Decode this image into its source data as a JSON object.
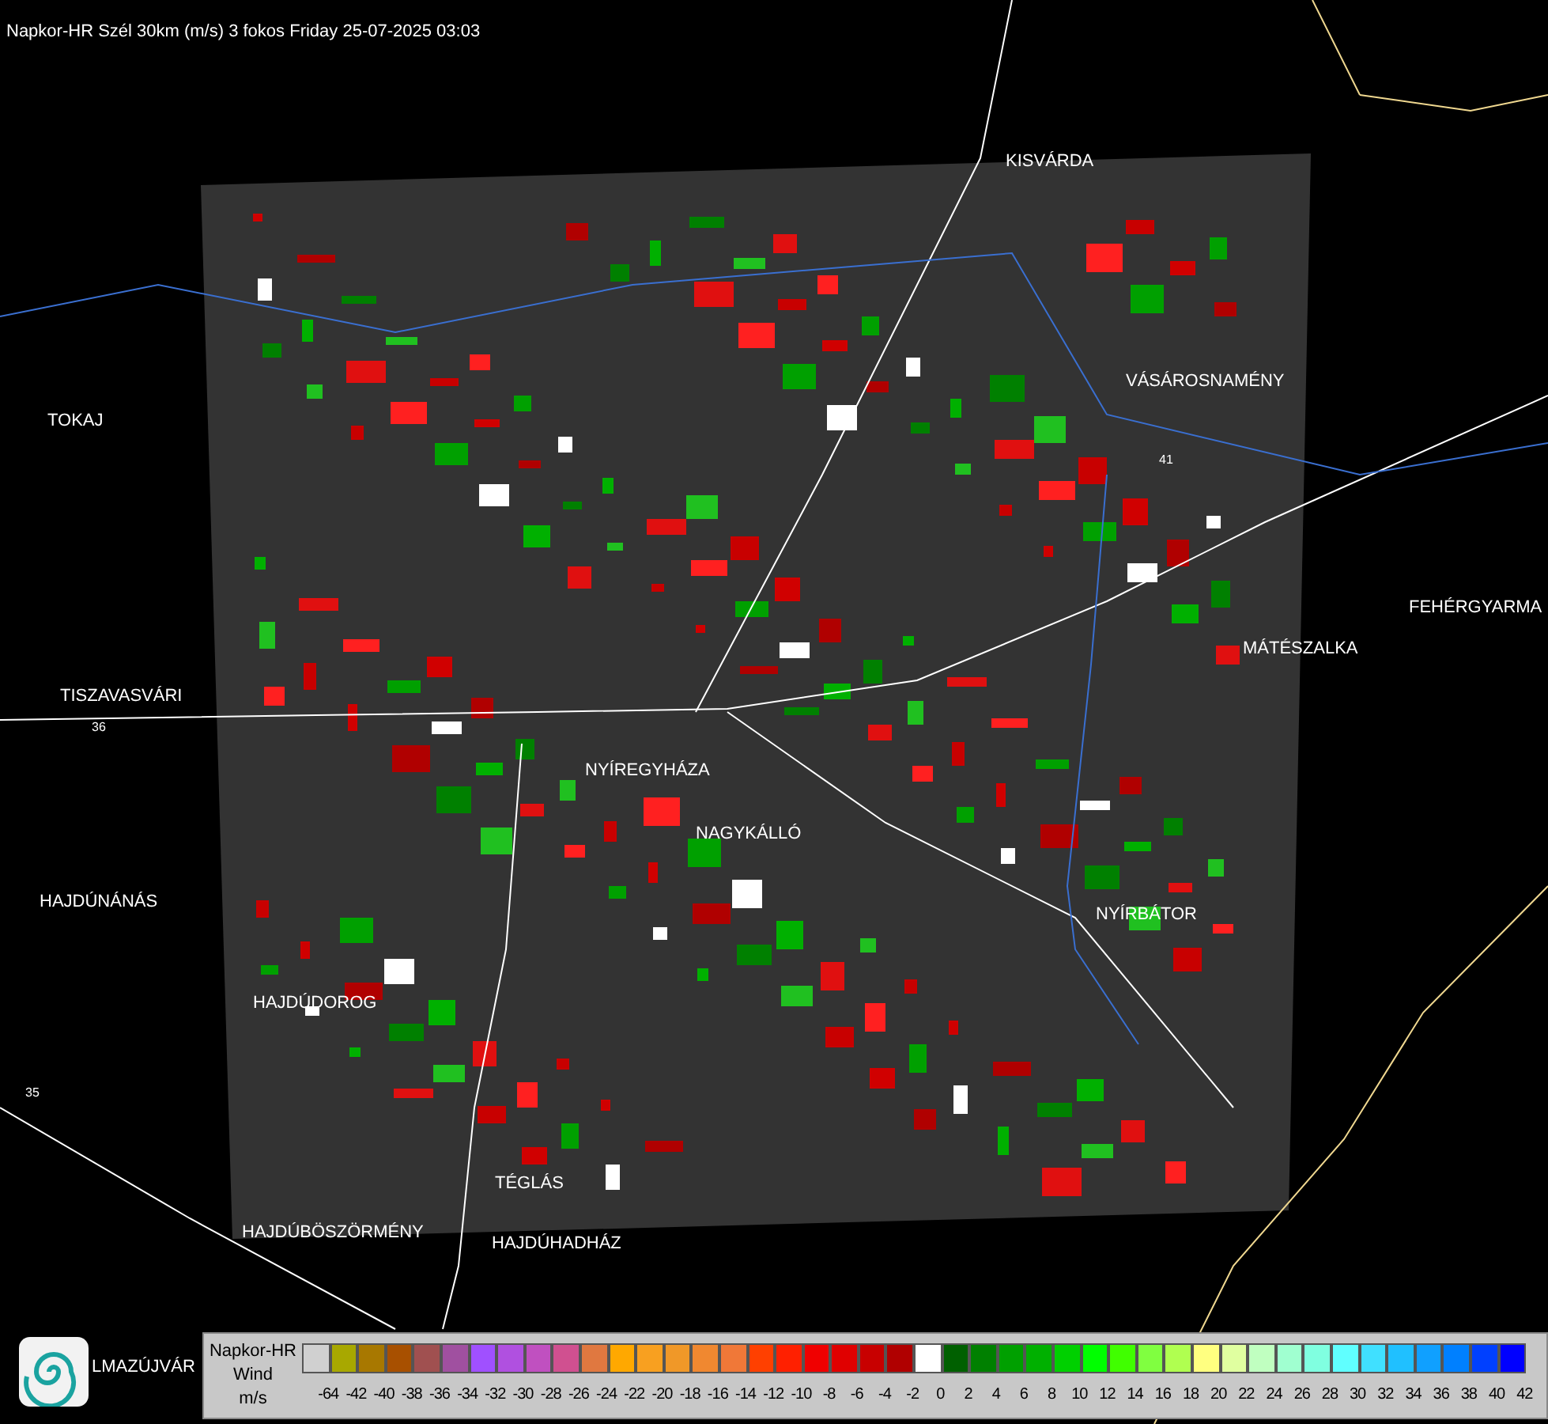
{
  "title": "Napkor-HR Szél 30km (m/s) 3 fokos Friday 25-07-2025 03:03",
  "map": {
    "cities": [
      {
        "name": "KISVÁRDA"
      },
      {
        "name": "VÁSÁROSNAMÉNY"
      },
      {
        "name": "TOKAJ"
      },
      {
        "name": "FEHÉRGYARMA"
      },
      {
        "name": "MÁTÉSZALKA"
      },
      {
        "name": "TISZAVASVÁRI"
      },
      {
        "name": "NYÍREGYHÁZA"
      },
      {
        "name": "NAGYKÁLLÓ"
      },
      {
        "name": "HAJDÚNÁNÁS"
      },
      {
        "name": "NYÍRBÁTOR"
      },
      {
        "name": "HAJDÚDOROG"
      },
      {
        "name": "TÉGLÁS"
      },
      {
        "name": "HAJDÚBÖSZÖRMÉNY"
      },
      {
        "name": "HAJDÚHADHÁZ"
      },
      {
        "name": "LMAZÚJVÁR"
      }
    ],
    "road_numbers": [
      "36",
      "41",
      "35"
    ]
  },
  "legend": {
    "lines": [
      "Napkor-HR",
      "Wind",
      "m/s"
    ],
    "scale": [
      {
        "color": "#d0d0d0",
        "label": "-64"
      },
      {
        "color": "#a8a800",
        "label": "-42"
      },
      {
        "color": "#a87800",
        "label": "-40"
      },
      {
        "color": "#a85000",
        "label": "-38"
      },
      {
        "color": "#a05050",
        "label": "-36"
      },
      {
        "color": "#a050a0",
        "label": "-34"
      },
      {
        "color": "#a050ff",
        "label": "-32"
      },
      {
        "color": "#b050e0",
        "label": "-30"
      },
      {
        "color": "#c050c0",
        "label": "-28"
      },
      {
        "color": "#d05090",
        "label": "-26"
      },
      {
        "color": "#e07840",
        "label": "-24"
      },
      {
        "color": "#ffa800",
        "label": "-22"
      },
      {
        "color": "#f8a020",
        "label": "-20"
      },
      {
        "color": "#f09828",
        "label": "-18"
      },
      {
        "color": "#f08830",
        "label": "-16"
      },
      {
        "color": "#f07838",
        "label": "-14"
      },
      {
        "color": "#ff4000",
        "label": "-12"
      },
      {
        "color": "#ff2000",
        "label": "-10"
      },
      {
        "color": "#f00000",
        "label": "-8"
      },
      {
        "color": "#e00000",
        "label": "-6"
      },
      {
        "color": "#c80000",
        "label": "-4"
      },
      {
        "color": "#b00000",
        "label": "-2"
      },
      {
        "color": "#ffffff",
        "label": "0"
      },
      {
        "color": "#006000",
        "label": "2"
      },
      {
        "color": "#008000",
        "label": "4"
      },
      {
        "color": "#00a000",
        "label": "6"
      },
      {
        "color": "#00b000",
        "label": "8"
      },
      {
        "color": "#00d000",
        "label": "10"
      },
      {
        "color": "#00ff00",
        "label": "12"
      },
      {
        "color": "#40ff00",
        "label": "14"
      },
      {
        "color": "#80ff40",
        "label": "16"
      },
      {
        "color": "#b0ff50",
        "label": "18"
      },
      {
        "color": "#ffff80",
        "label": "20"
      },
      {
        "color": "#e0ffa0",
        "label": "22"
      },
      {
        "color": "#c0ffc0",
        "label": "24"
      },
      {
        "color": "#a0ffd0",
        "label": "26"
      },
      {
        "color": "#80ffe0",
        "label": "28"
      },
      {
        "color": "#60ffff",
        "label": "30"
      },
      {
        "color": "#40e0ff",
        "label": "32"
      },
      {
        "color": "#20c0ff",
        "label": "34"
      },
      {
        "color": "#10a0ff",
        "label": "36"
      },
      {
        "color": "#0080ff",
        "label": "38"
      },
      {
        "color": "#0040ff",
        "label": "40"
      },
      {
        "color": "#0000ff",
        "label": "42"
      }
    ]
  }
}
